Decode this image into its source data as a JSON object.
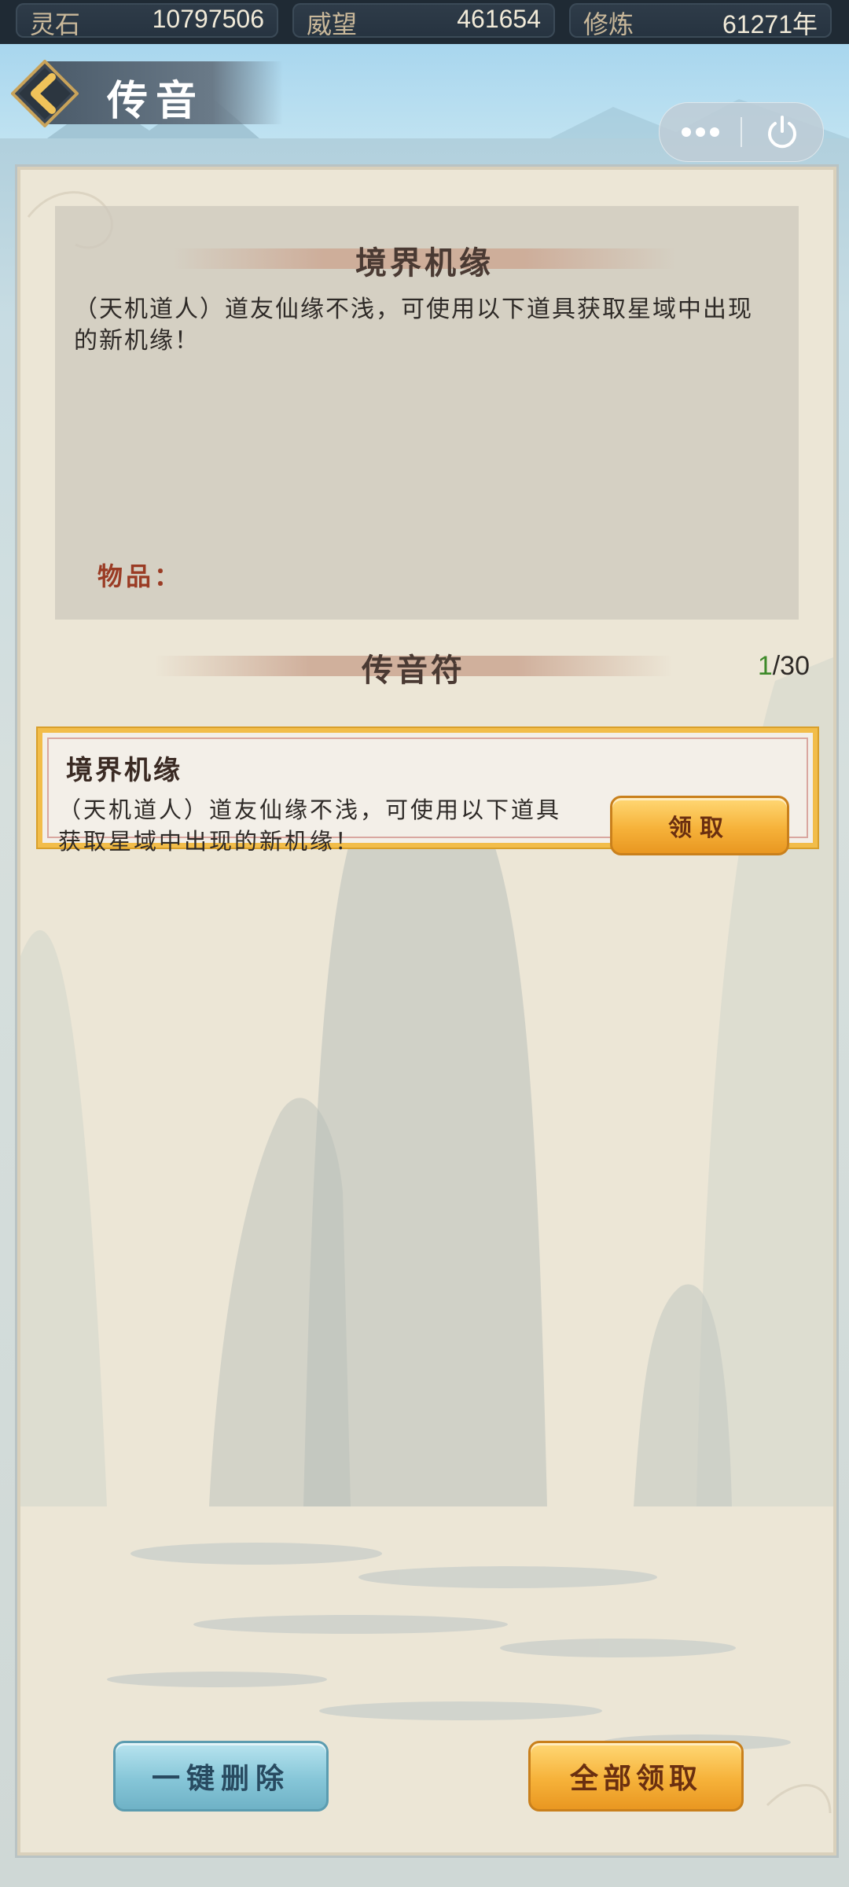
{
  "resources": [
    {
      "label": "灵石",
      "value": "10797506"
    },
    {
      "label": "威望",
      "value": "461654"
    },
    {
      "label": "修炼",
      "value": "61271年"
    }
  ],
  "header": {
    "title": "传音"
  },
  "detail": {
    "heading": "境界机缘",
    "body": "（天机道人）道友仙缘不浅，可使用以下道具获取星域中出现的新机缘！",
    "items_label": "物品："
  },
  "list": {
    "heading": "传音符",
    "count_current": "1",
    "count_total": "/30"
  },
  "mails": [
    {
      "title": "境界机缘",
      "text": "（天机道人）道友仙缘不浅，可使用以下道具获取星域中出现的新机缘！",
      "action_label": "领取"
    }
  ],
  "footer": {
    "delete_all_label": "一键删除",
    "claim_all_label": "全部领取"
  },
  "icons": {
    "back": "chevron-left-icon",
    "more": "more-dots-icon",
    "power": "power-icon"
  }
}
